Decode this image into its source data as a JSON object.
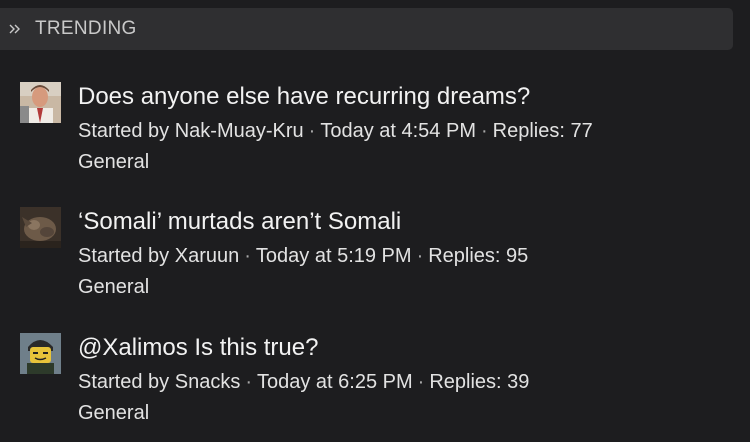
{
  "header": {
    "title": "TRENDING",
    "icon": "double-chevron-right-icon"
  },
  "threads": [
    {
      "title": "Does anyone else have recurring dreams?",
      "started_by_prefix": "Started by",
      "author": "Nak-Muay-Kru",
      "time": "Today at 4:54 PM",
      "replies": "Replies: 77",
      "forum": "General"
    },
    {
      "title": "‘Somali’ murtads aren’t Somali",
      "started_by_prefix": "Started by",
      "author": "Xaruun",
      "time": "Today at 5:19 PM",
      "replies": "Replies: 95",
      "forum": "General"
    },
    {
      "title": "@Xalimos Is this true?",
      "started_by_prefix": "Started by",
      "author": "Snacks",
      "time": "Today at 6:25 PM",
      "replies": "Replies: 39",
      "forum": "General"
    }
  ],
  "colors": {
    "background": "#1d1d1f",
    "header_bg": "#2f2f31",
    "text": "#ececec"
  }
}
